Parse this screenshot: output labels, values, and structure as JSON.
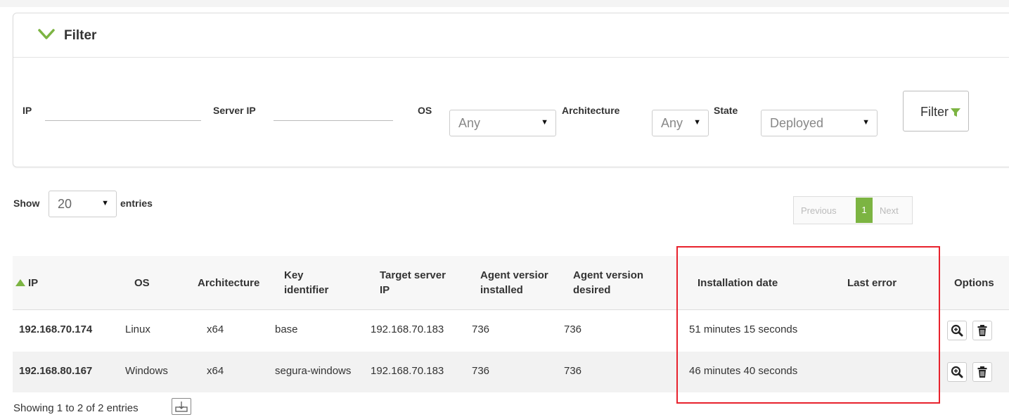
{
  "filter": {
    "title": "Filter",
    "ip_label": "IP",
    "ip_value": "",
    "server_ip_label": "Server IP",
    "server_ip_value": "",
    "os_label": "OS",
    "os_value": "Any",
    "architecture_label": "Architecture",
    "architecture_value": "Any",
    "state_label": "State",
    "state_value": "Deployed",
    "button_label": "Filter",
    "accent_color": "#7cb442"
  },
  "entries": {
    "show_label": "Show",
    "page_size": "20",
    "entries_label": "entries"
  },
  "pagination": {
    "previous": "Previous",
    "current": "1",
    "next": "Next"
  },
  "table": {
    "columns": {
      "ip": "IP",
      "os": "OS",
      "architecture": "Architecture",
      "key_identifier": [
        "Key",
        "identifier"
      ],
      "target_server_ip": [
        "Target server",
        "IP"
      ],
      "agent_version_installed": [
        "Agent versior",
        "installed"
      ],
      "agent_version_desired": [
        "Agent version",
        "desired"
      ],
      "installation_date": "Installation date",
      "last_error": "Last error",
      "options": "Options"
    },
    "rows": [
      {
        "ip": "192.168.70.174",
        "os": "Linux",
        "architecture": "x64",
        "key_identifier": "base",
        "target_server_ip": "192.168.70.183",
        "agent_version_installed": "736",
        "agent_version_desired": "736",
        "installation_date": "51 minutes 15 seconds",
        "last_error": ""
      },
      {
        "ip": "192.168.80.167",
        "os": "Windows",
        "architecture": "x64",
        "key_identifier": "segura-windows",
        "target_server_ip": "192.168.70.183",
        "agent_version_installed": "736",
        "agent_version_desired": "736",
        "installation_date": "46 minutes 40 seconds",
        "last_error": ""
      }
    ],
    "sort_icon": "sort-ascending-icon",
    "highlight_color": "#e8222d"
  },
  "footer": {
    "showing_text": "Showing 1 to 2 of 2 entries",
    "export_icon": "export-csv-icon"
  }
}
